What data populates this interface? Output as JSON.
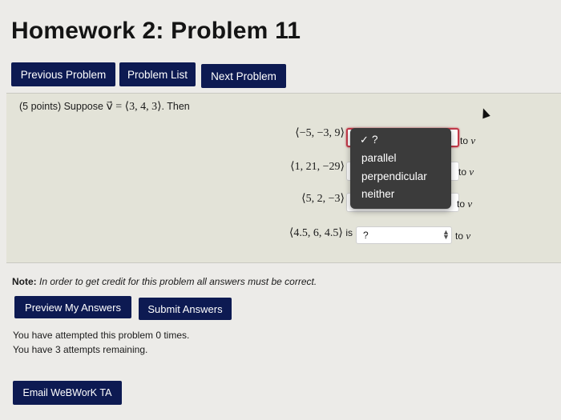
{
  "page_title": "Homework 2: Problem 11",
  "nav": {
    "previous": "Previous Problem",
    "list": "Problem List",
    "next": "Next Problem"
  },
  "problem": {
    "points": "(5 points)",
    "suppose": "Suppose",
    "v_symbol": "v⃗",
    "equals": "=",
    "v_value": "⟨3, 4, 3⟩",
    "then": ". Then",
    "rows": [
      {
        "vector": "⟨−5, −3, 9⟩",
        "suffix": "",
        "selected": "?",
        "to": "to"
      },
      {
        "vector": "⟨1, 21, −29⟩",
        "suffix": "",
        "selected": "",
        "to": "to"
      },
      {
        "vector": "⟨5, 2, −3⟩",
        "suffix": "",
        "selected": "",
        "to": "to"
      },
      {
        "vector": "⟨4.5, 6, 4.5⟩",
        "suffix": "is",
        "selected": "?",
        "to": "to"
      }
    ],
    "dropdown": {
      "check": "✓",
      "options": [
        "?",
        "parallel",
        "perpendicular",
        "neither"
      ]
    }
  },
  "note": {
    "label": "Note:",
    "text": "In order to get credit for this problem all answers must be correct."
  },
  "buttons": {
    "preview": "Preview My Answers",
    "submit": "Submit Answers",
    "email": "Email WeBWorK TA"
  },
  "attempts": {
    "line1": "You have attempted this problem 0 times.",
    "line2": "You have 3 attempts remaining."
  },
  "colors": {
    "button_bg": "#0d1a52",
    "problem_bg": "#e3e3d8",
    "dropdown_bg": "#3b3b3b",
    "active_border": "#c23a4a"
  }
}
